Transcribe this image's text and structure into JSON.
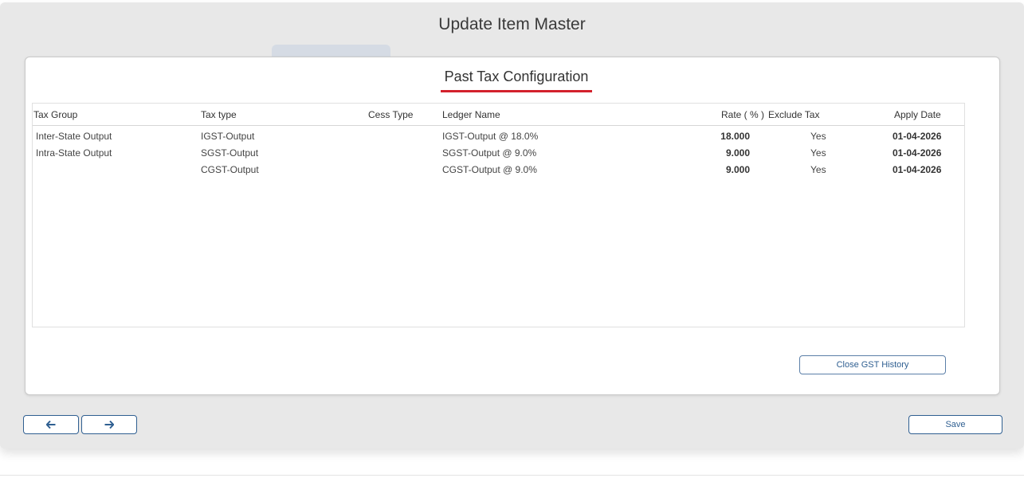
{
  "window": {
    "title": "Update Item Master"
  },
  "modal": {
    "title": "Past Tax Configuration",
    "close_label": "Close GST History"
  },
  "table": {
    "headers": {
      "tax_group": "Tax Group",
      "tax_type": "Tax type",
      "cess_type": "Cess Type",
      "ledger_name": "Ledger Name",
      "rate": "Rate ( % )",
      "exclude_tax": "Exclude Tax",
      "apply_date": "Apply Date"
    },
    "rows": [
      {
        "tax_group": "Inter-State Output",
        "tax_type": "IGST-Output",
        "cess_type": "",
        "ledger_name": "IGST-Output @ 18.0%",
        "rate": "18.000",
        "exclude_tax": "Yes",
        "apply_date": "01-04-2026"
      },
      {
        "tax_group": "Intra-State Output",
        "tax_type": "SGST-Output",
        "cess_type": "",
        "ledger_name": "SGST-Output @ 9.0%",
        "rate": "9.000",
        "exclude_tax": "Yes",
        "apply_date": "01-04-2026"
      },
      {
        "tax_group": "",
        "tax_type": "CGST-Output",
        "cess_type": "",
        "ledger_name": "CGST-Output @ 9.0%",
        "rate": "9.000",
        "exclude_tax": "Yes",
        "apply_date": "01-04-2026"
      }
    ]
  },
  "footer": {
    "prev_icon": "arrow-left-icon",
    "next_icon": "arrow-right-icon",
    "save_label": "Save"
  },
  "colors": {
    "accent_underline": "#d3212c",
    "button_border": "#2f5f91"
  }
}
